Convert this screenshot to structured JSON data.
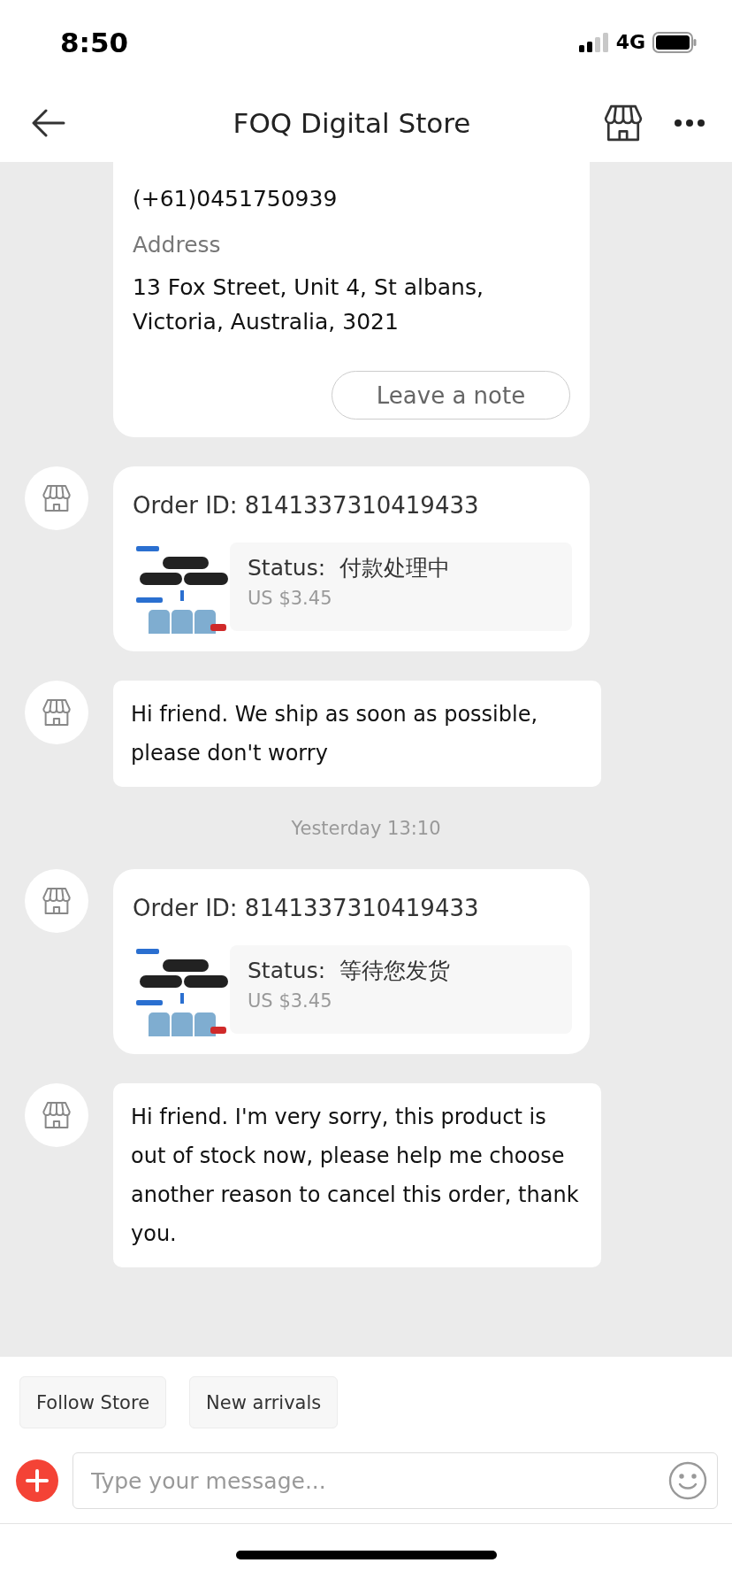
{
  "status_bar": {
    "time": "8:50",
    "network": "4G"
  },
  "header": {
    "title": "FOQ Digital Store"
  },
  "messages": [
    {
      "kind": "address_card",
      "phone": "(+61)0451750939",
      "address_label": "Address",
      "address": "13 Fox Street, Unit 4, St albans, Victoria, Australia, 3021",
      "button": "Leave a note"
    },
    {
      "kind": "order",
      "order_id": "Order ID: 8141337310419433",
      "status": "Status:  付款处理中",
      "price": "US $3.45"
    },
    {
      "kind": "text",
      "text": "Hi friend. We ship as soon as possible, please don't worry"
    },
    {
      "kind": "timestamp",
      "text": "Yesterday 13:10"
    },
    {
      "kind": "order",
      "order_id": "Order ID: 8141337310419433",
      "status": "Status:  等待您发货",
      "price": "US $3.45"
    },
    {
      "kind": "text",
      "text": "Hi friend. I'm very sorry, this product is out of stock now, please help me choose another reason to cancel this order, thank you."
    }
  ],
  "quick_replies": [
    "Follow Store",
    "New arrivals"
  ],
  "composer": {
    "placeholder": "Type your message..."
  }
}
